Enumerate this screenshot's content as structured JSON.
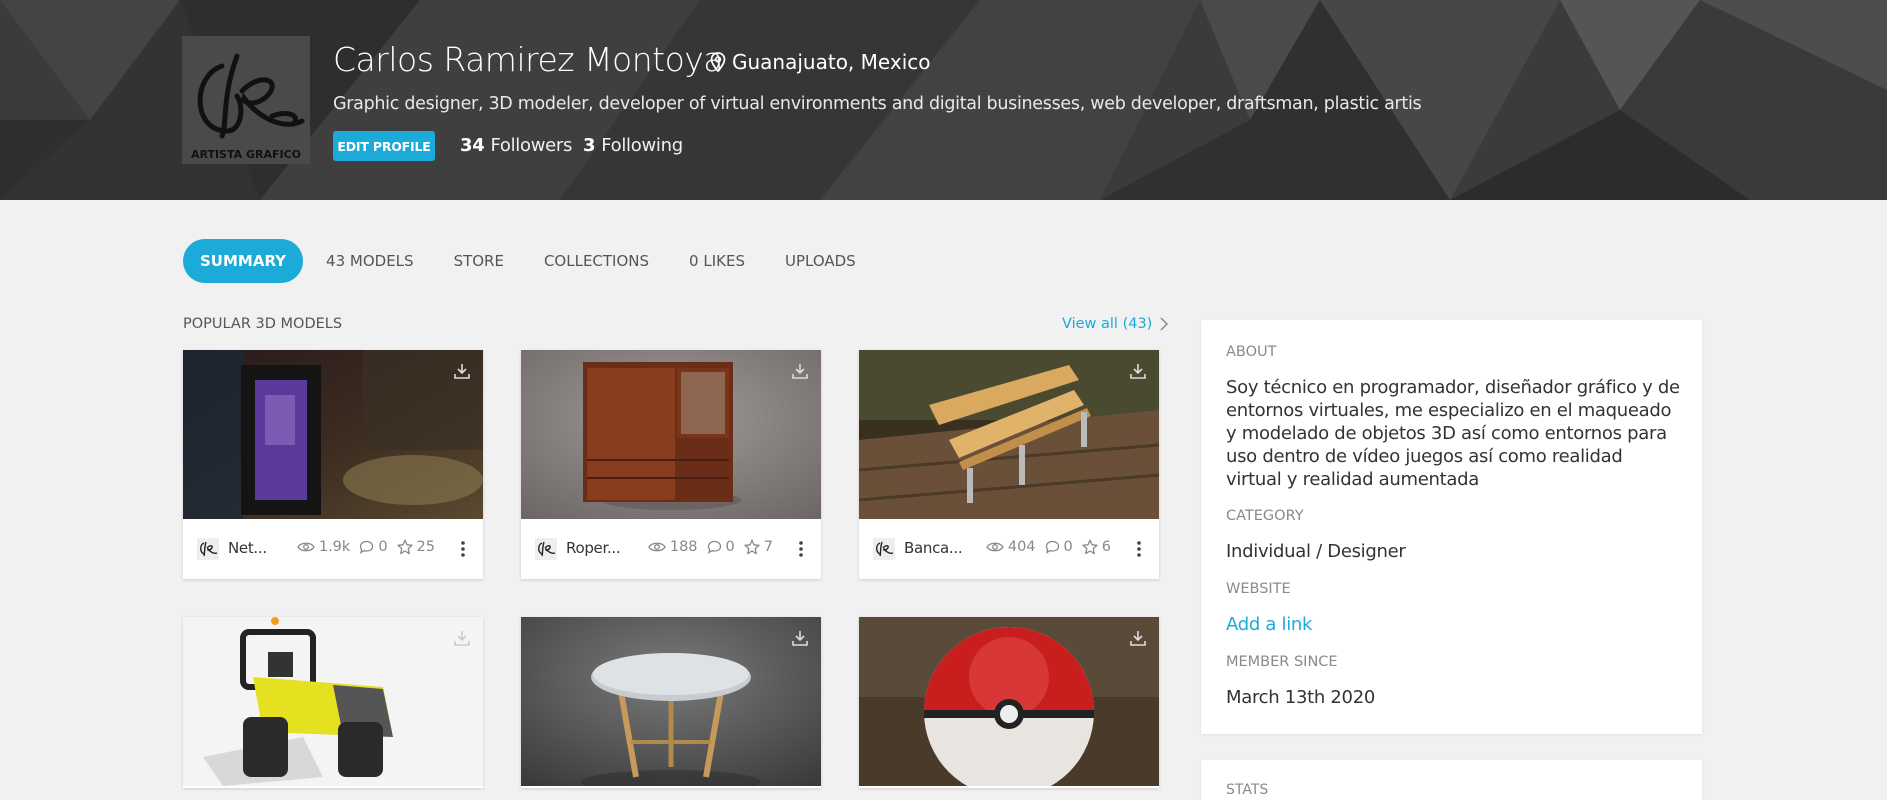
{
  "profile": {
    "name": "Carlos Ramirez Montoya",
    "location": "Guanajuato, Mexico",
    "bio": "Graphic designer, 3D modeler, developer of virtual environments and digital businesses, web developer, draftsman, plastic artis",
    "edit_label": "EDIT PROFILE",
    "followers_count": "34",
    "followers_label": "Followers",
    "following_count": "3",
    "following_label": "Following",
    "avatar_text": "ARTISTA GRAFICO"
  },
  "tabs": [
    {
      "label": "SUMMARY",
      "active": true
    },
    {
      "label": "43 MODELS"
    },
    {
      "label": "STORE"
    },
    {
      "label": "COLLECTIONS"
    },
    {
      "label": "0 LIKES"
    },
    {
      "label": "UPLOADS"
    }
  ],
  "popular": {
    "title": "POPULAR 3D MODELS",
    "view_all": "View all (43)"
  },
  "models": [
    {
      "name": "Net...",
      "views": "1.9k",
      "comments": "0",
      "likes": "25"
    },
    {
      "name": "Roper...",
      "views": "188",
      "comments": "0",
      "likes": "7"
    },
    {
      "name": "Banca...",
      "views": "404",
      "comments": "0",
      "likes": "6"
    },
    {
      "name": "",
      "views": "",
      "comments": "",
      "likes": ""
    },
    {
      "name": "",
      "views": "",
      "comments": "",
      "likes": ""
    },
    {
      "name": "",
      "views": "",
      "comments": "",
      "likes": ""
    }
  ],
  "about": {
    "title": "ABOUT",
    "description": "Soy técnico en programador, diseñador gráfico y de entornos virtuales, me especializo en el maqueado y modelado de objetos 3D así como entornos para uso dentro de vídeo juegos así como realidad virtual y realidad aumentada",
    "category_label": "CATEGORY",
    "category_value": "Individual / Designer",
    "website_label": "WEBSITE",
    "website_value": "Add a link",
    "member_label": "MEMBER SINCE",
    "member_value": "March 13th 2020"
  },
  "stats_box": {
    "title": "STATS"
  },
  "colors": {
    "accent": "#1caad9",
    "header_bg": "#3a3a3a",
    "page_bg": "#f1f1f1"
  }
}
